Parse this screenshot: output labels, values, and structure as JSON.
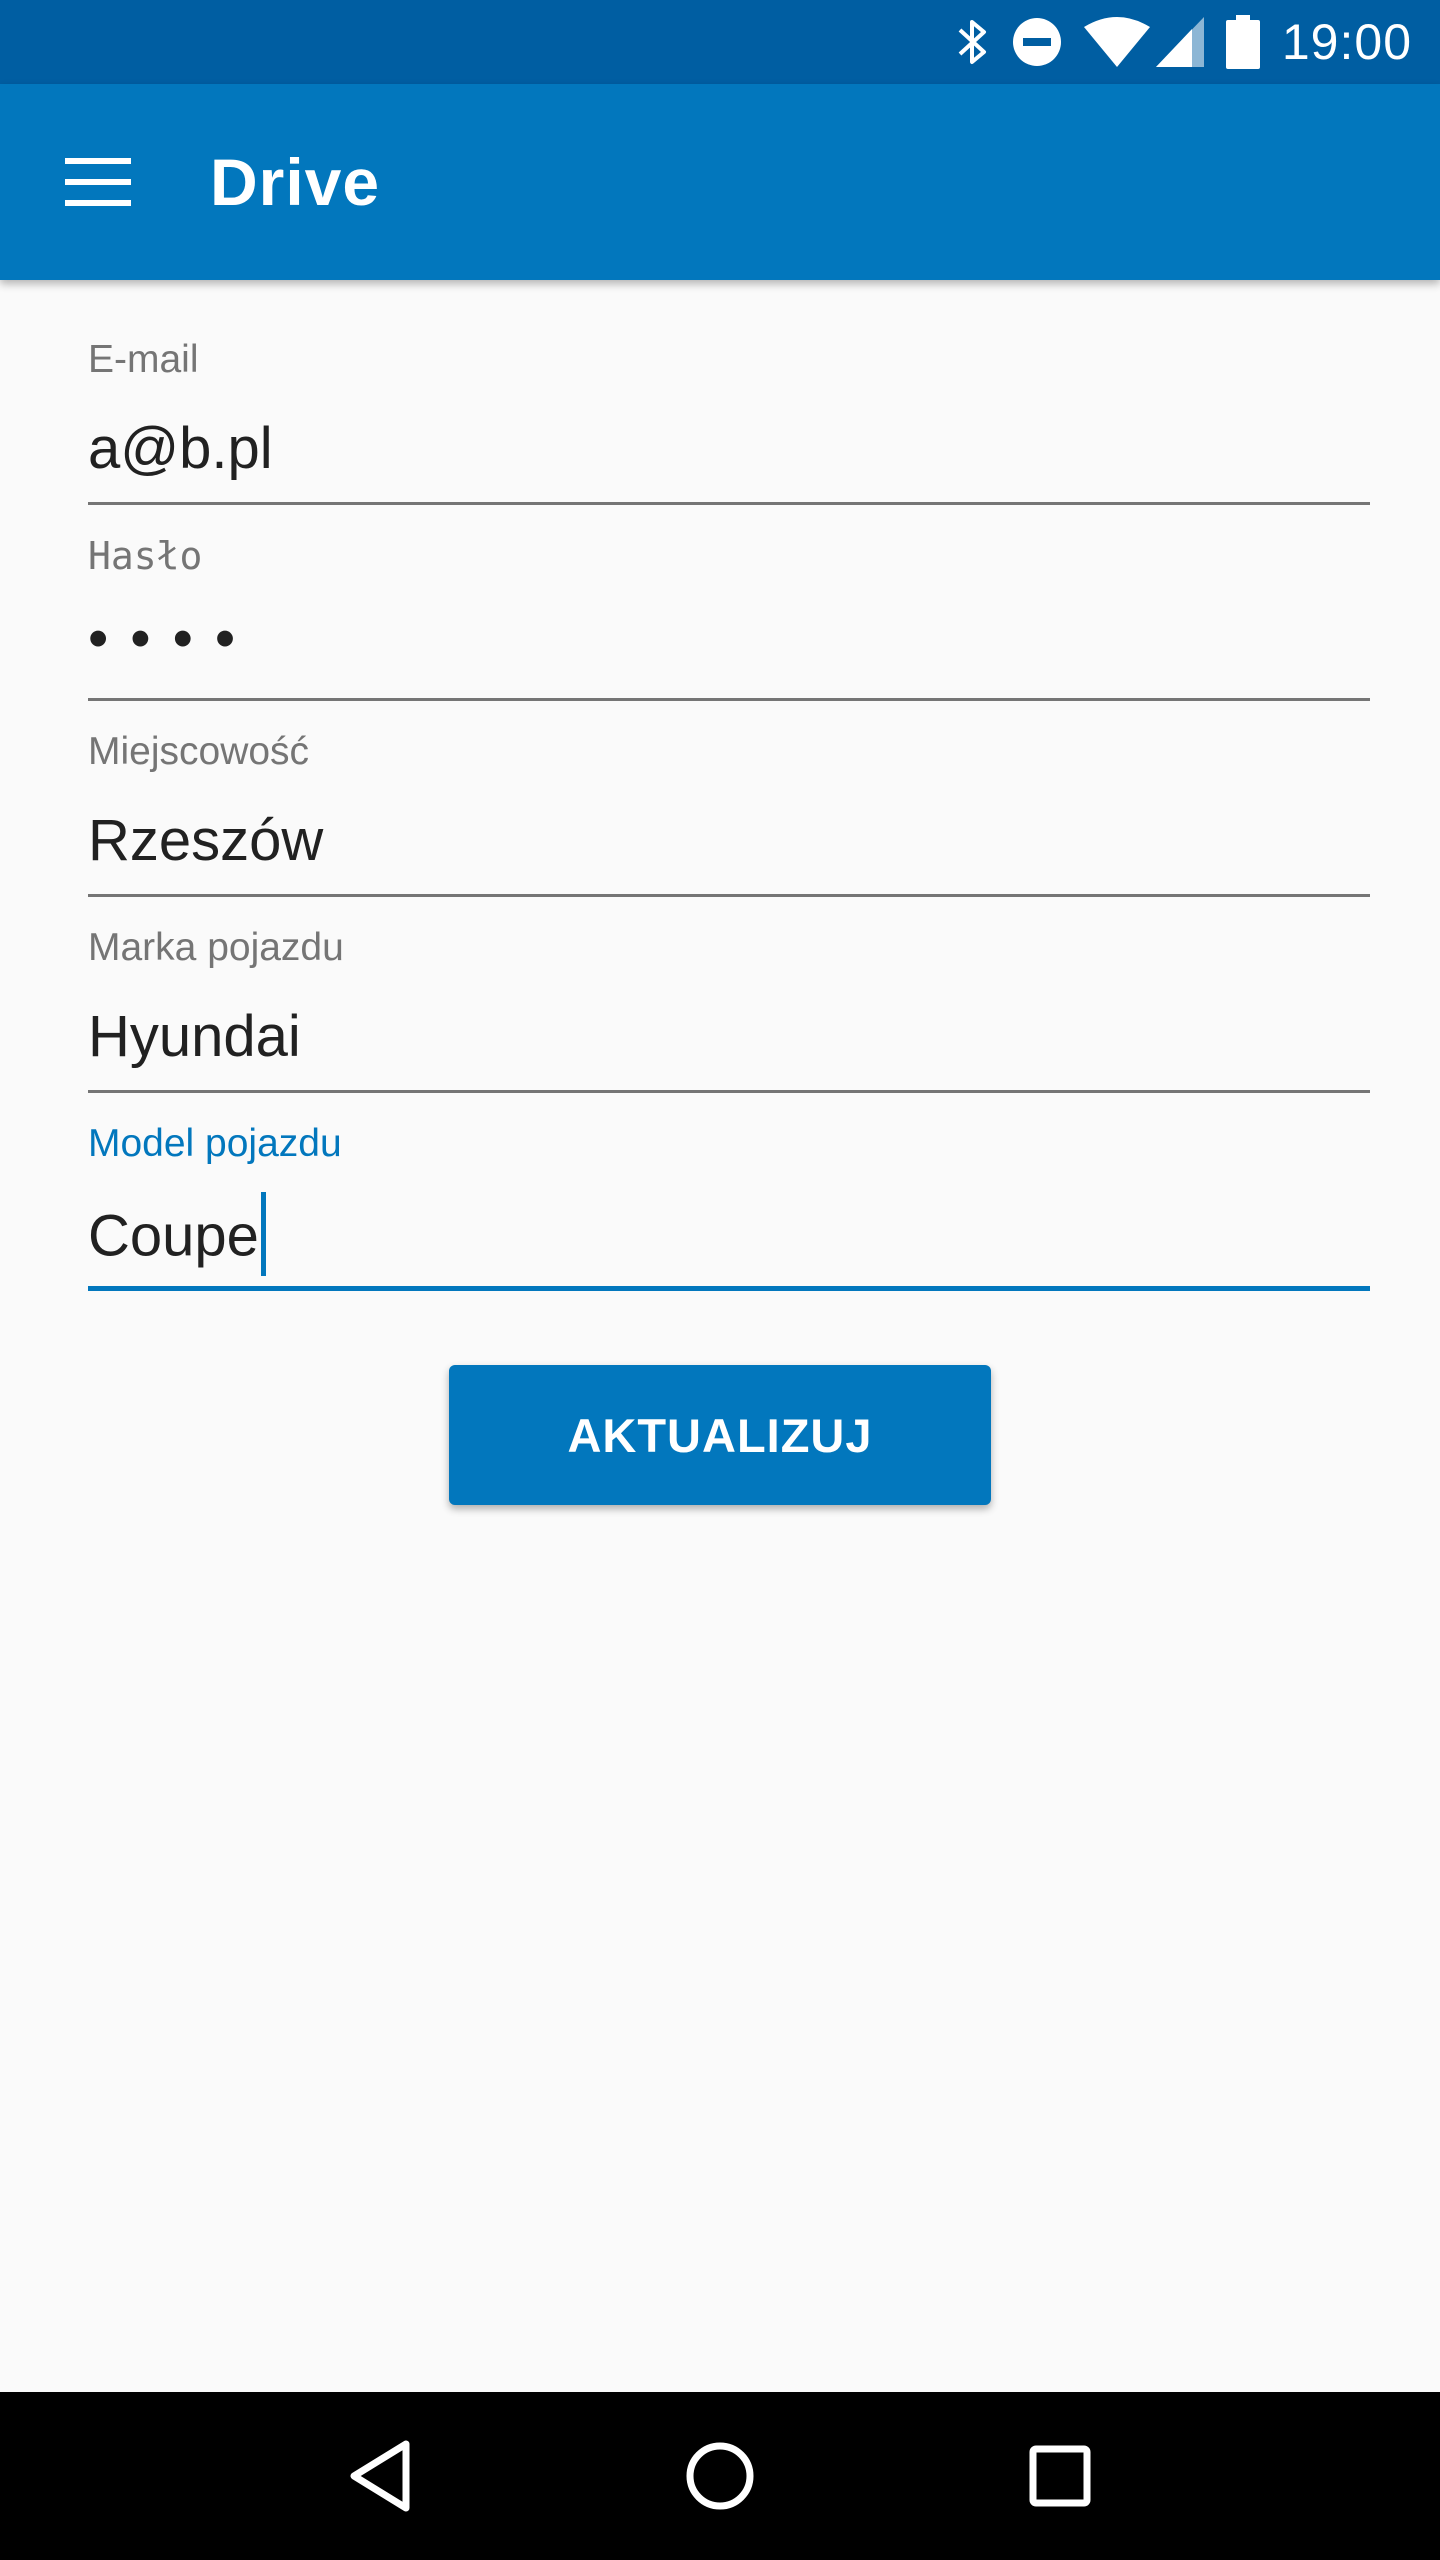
{
  "status_bar": {
    "time": "19:00",
    "icons": [
      "bluetooth-icon",
      "do-not-disturb-icon",
      "wifi-icon",
      "cell-signal-icon",
      "battery-icon"
    ],
    "background_color": "#005ea2"
  },
  "app_bar": {
    "title": "Drive",
    "menu_icon": "hamburger-menu-icon",
    "background_color": "#0277bd"
  },
  "form": {
    "email": {
      "label": "E-mail",
      "value": "a@b.pl"
    },
    "password": {
      "label": "Hasło",
      "value": "••••"
    },
    "city": {
      "label": "Miejscowość",
      "value": "Rzeszów"
    },
    "vehicle_brand": {
      "label": "Marka pojazdu",
      "value": "Hyundai"
    },
    "vehicle_model": {
      "label": "Model pojazdu",
      "value": "Coupe",
      "focused": true
    }
  },
  "update_button": {
    "label": "AKTUALIZUJ"
  },
  "nav_bar": {
    "back_icon": "back-triangle-icon",
    "home_icon": "home-circle-icon",
    "recents_icon": "recents-square-icon"
  },
  "colors": {
    "accent": "#0277bd",
    "label_gray": "#757575",
    "text": "#212121",
    "background": "#fafafa"
  }
}
